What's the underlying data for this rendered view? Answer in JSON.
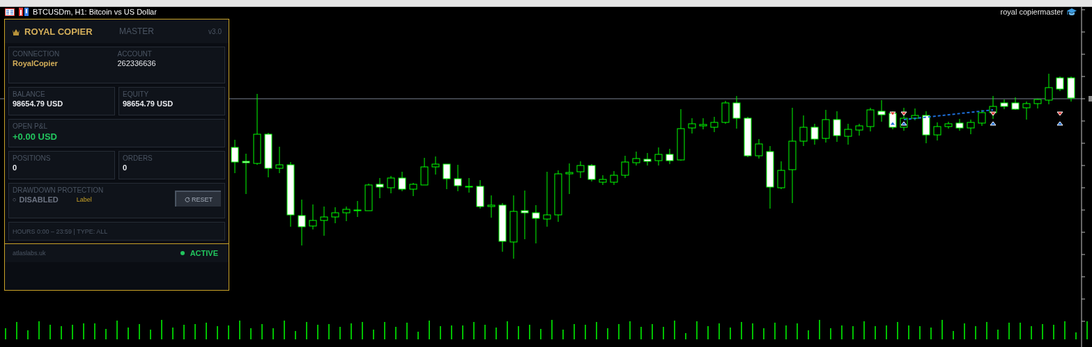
{
  "chart_window": {
    "title": "BTCUSDm, H1:  Bitcoin vs US Dollar",
    "corner_label": "royal copiermaster"
  },
  "panel": {
    "brand": "ROYAL COPIER",
    "mode": "MASTER",
    "version": "v3.0",
    "connection": {
      "label": "CONNECTION",
      "value": "RoyalCopier"
    },
    "account": {
      "label": "ACCOUNT",
      "value": "262336636"
    },
    "stats": [
      {
        "label": "BALANCE",
        "value": "98654.79 USD",
        "kind": "half"
      },
      {
        "label": "EQUITY",
        "value": "98654.79 USD",
        "kind": "half"
      },
      {
        "label": "OPEN P&L",
        "value": "+0.00 USD",
        "kind": "pnl"
      },
      {
        "label": "POSITIONS",
        "value": "0",
        "kind": "half"
      },
      {
        "label": "ORDERS",
        "value": "0",
        "kind": "half"
      }
    ],
    "drawdown": {
      "label": "DRAWDOWN PROTECTION",
      "status_glyph": "○",
      "status": "DISABLED",
      "enabled": false,
      "note": "Label",
      "reset_button": {
        "label": "RESET",
        "disabled": true
      }
    },
    "hours": "HOURS  0:00 – 23:59  |  TYPE: ALL",
    "footer": {
      "site": "atlaslabs.uk",
      "status": "ACTIVE",
      "color": "#22c55e"
    }
  }
}
